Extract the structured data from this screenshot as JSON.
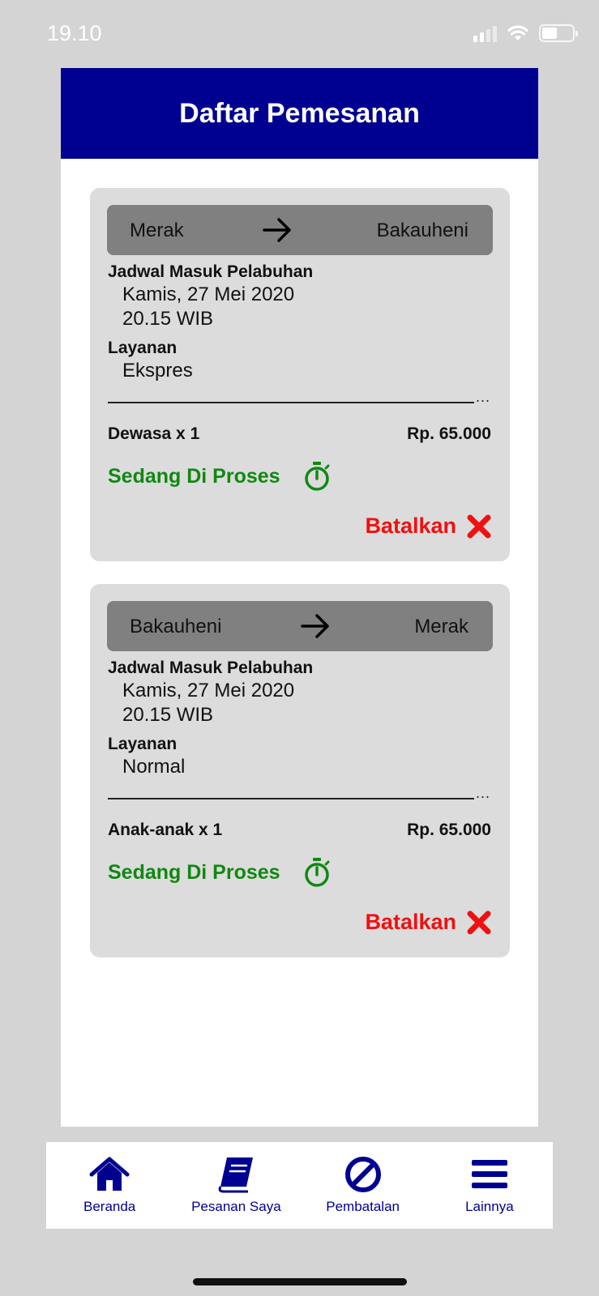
{
  "status_bar": {
    "time": "19.10"
  },
  "header": {
    "title": "Daftar Pemesanan"
  },
  "bookings": [
    {
      "from": "Merak",
      "to": "Bakauheni",
      "schedule_label": "Jadwal Masuk Pelabuhan",
      "date": "Kamis, 27 Mei 2020",
      "time": "20.15 WIB",
      "service_label": "Layanan",
      "service": "Ekspres",
      "divider_suffix": "...",
      "passenger": "Dewasa x 1",
      "price": "Rp. 65.000",
      "status": "Sedang Di Proses",
      "cancel_label": "Batalkan"
    },
    {
      "from": "Bakauheni",
      "to": "Merak",
      "schedule_label": "Jadwal Masuk Pelabuhan",
      "date": "Kamis, 27 Mei 2020",
      "time": "20.15 WIB",
      "service_label": "Layanan",
      "service": "Normal",
      "divider_suffix": "...",
      "passenger": "Anak-anak x 1",
      "price": "Rp. 65.000",
      "status": "Sedang Di Proses",
      "cancel_label": "Batalkan"
    }
  ],
  "tabs": [
    {
      "label": "Beranda",
      "icon": "home-icon"
    },
    {
      "label": "Pesanan Saya",
      "icon": "book-icon"
    },
    {
      "label": "Pembatalan",
      "icon": "ban-icon"
    },
    {
      "label": "Lainnya",
      "icon": "menu-icon"
    }
  ],
  "colors": {
    "primary": "#000090",
    "status_green": "#118811",
    "cancel_red": "#ee1111",
    "card_bg": "#dcdcdc",
    "route_bar_bg": "#808080"
  }
}
